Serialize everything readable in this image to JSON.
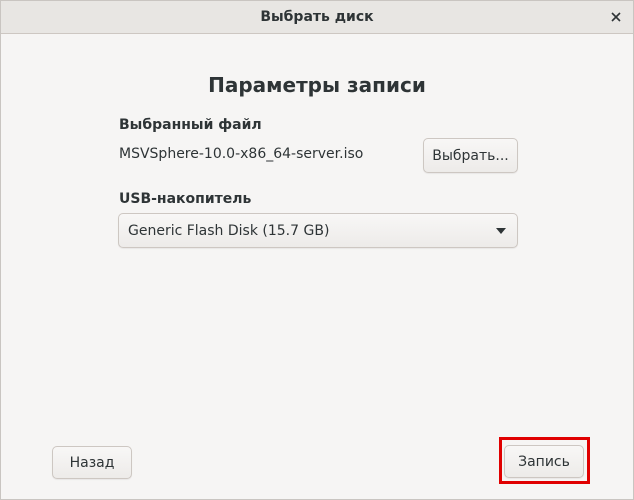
{
  "window": {
    "title": "Выбрать диск"
  },
  "main": {
    "heading": "Параметры записи",
    "file": {
      "label": "Выбранный файл",
      "filename": "MSVSphere-10.0-x86_64-server.iso",
      "choose_button": "Выбрать..."
    },
    "usb": {
      "label": "USB-накопитель",
      "selected": "Generic Flash Disk (15.7 GB)"
    }
  },
  "footer": {
    "back_button": "Назад",
    "write_button": "Запись"
  },
  "colors": {
    "background": "#f6f5f4",
    "highlight": "#e00000"
  },
  "icons": {
    "close": "close-icon",
    "dropdown": "chevron-down-icon"
  }
}
